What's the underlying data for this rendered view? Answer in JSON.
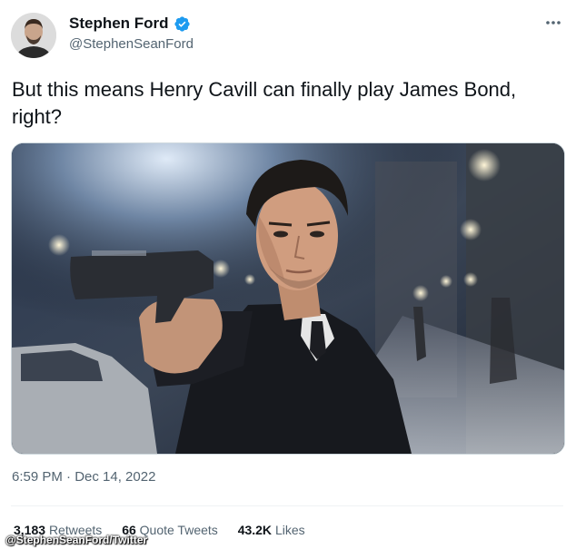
{
  "author": {
    "display_name": "Stephen Ford",
    "handle": "@StephenSeanFord",
    "verified": true,
    "verified_color": "#1d9bf0",
    "avatar_icon": "profile-photo"
  },
  "tweet": {
    "text": "But this means Henry Cavill can finally play James Bond, right?",
    "media_icon": "photo-man-in-suit-aiming-pistol",
    "timestamp": "6:59 PM · Dec 14, 2022"
  },
  "stats": {
    "retweets_count": "3,183",
    "retweets_label": "Retweets",
    "quotes_count": "66",
    "quotes_label": "Quote Tweets",
    "likes_count": "43.2K",
    "likes_label": "Likes"
  },
  "credit": "@StephenSeanFord/Twitter",
  "colors": {
    "text_primary": "#0f1419",
    "text_secondary": "#536471",
    "accent": "#1d9bf0"
  }
}
